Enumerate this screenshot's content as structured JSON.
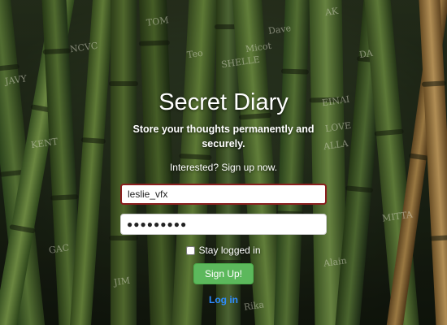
{
  "page": {
    "title": "Secret Diary",
    "lead": "Store your thoughts permanently and securely.",
    "subtitle": "Interested? Sign up now."
  },
  "form": {
    "username_value": "leslie_vfx",
    "password_value": "●●●●●●●●●",
    "stay_logged_in_label": "Stay logged in",
    "stay_logged_in_checked": false,
    "signup_label": "Sign Up!",
    "login_link_label": "Log in"
  },
  "background": {
    "scribbles": [
      "AK",
      "Micot",
      "JAVY",
      "KENT",
      "SHELLE",
      "LOVE",
      "Dave",
      "NCVC",
      "ALLA",
      "EINAI",
      "GAC",
      "Alain",
      "TOM",
      "DA",
      "JIM",
      "Rika",
      "Teo",
      "MITTA"
    ]
  },
  "colors": {
    "primary_button": "#5cb85c",
    "link": "#2d8cff",
    "focused_border": "#8a1f1f"
  }
}
